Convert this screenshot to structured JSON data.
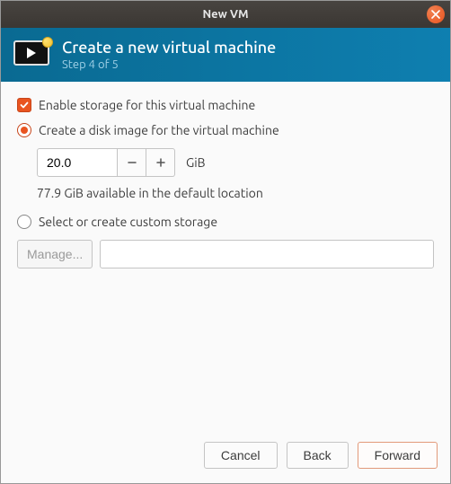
{
  "titlebar": {
    "title": "New VM"
  },
  "banner": {
    "title": "Create a new virtual machine",
    "step": "Step 4 of 5"
  },
  "storage": {
    "enable_label": "Enable storage for this virtual machine",
    "enable_checked": true,
    "create_disk_label": "Create a disk image for the virtual machine",
    "create_disk_selected": true,
    "size_value": "20.0",
    "size_unit": "GiB",
    "available_text": "77.9 GiB available in the default location",
    "custom_label": "Select or create custom storage",
    "custom_selected": false,
    "manage_label": "Manage...",
    "path_value": ""
  },
  "footer": {
    "cancel": "Cancel",
    "back": "Back",
    "forward": "Forward"
  }
}
